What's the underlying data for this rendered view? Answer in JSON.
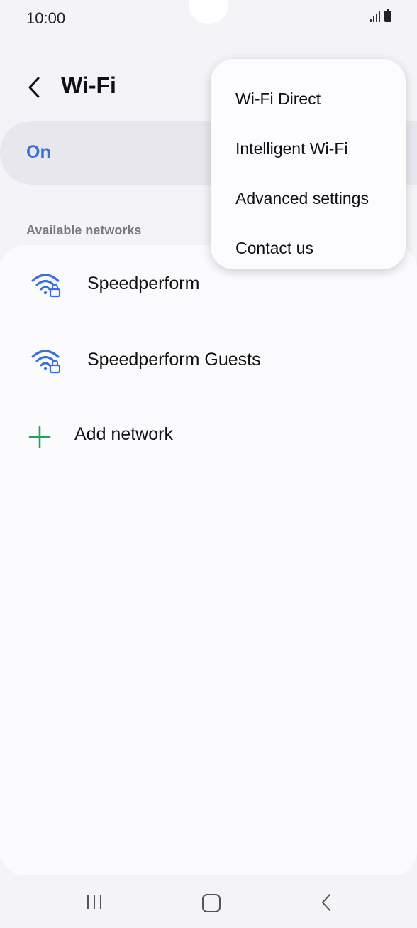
{
  "status_bar": {
    "time": "10:00"
  },
  "header": {
    "title": "Wi-Fi"
  },
  "toggle": {
    "label": "On"
  },
  "networks": {
    "section_label": "Available networks",
    "items": [
      {
        "name": "Speedperform",
        "icon": "wifi-locked-icon"
      },
      {
        "name": "Speedperform Guests",
        "icon": "wifi-locked-icon"
      }
    ],
    "add_label": "Add network"
  },
  "menu": {
    "items": [
      {
        "label": "Wi-Fi Direct"
      },
      {
        "label": "Intelligent Wi-Fi"
      },
      {
        "label": "Advanced settings"
      },
      {
        "label": "Contact us"
      }
    ]
  },
  "colors": {
    "accent": "#3a6fd8",
    "add_green": "#1aa65a",
    "background": "#f3f3f8"
  }
}
